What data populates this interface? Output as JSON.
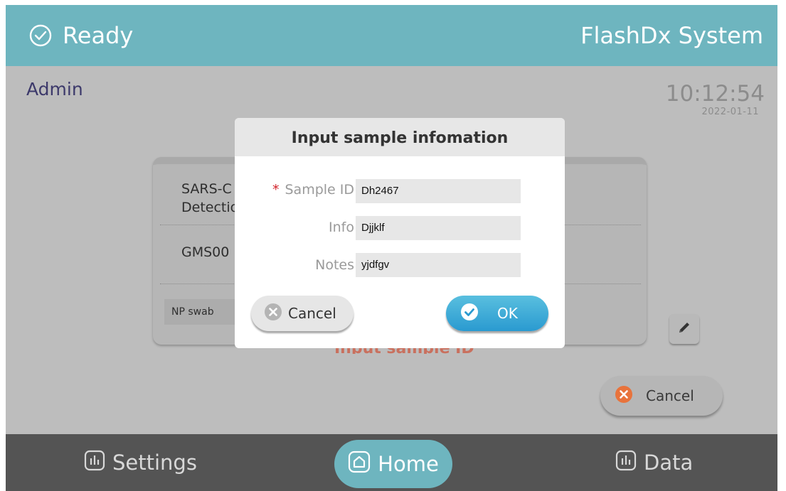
{
  "header": {
    "status_text": "Ready",
    "status_icon": "check-circle-icon",
    "system_title": "FlashDx System"
  },
  "user": {
    "name": "Admin"
  },
  "clock": {
    "time": "10:12:54",
    "date": "2022-01-11"
  },
  "card": {
    "test_name": "SARS-C\nDetectio",
    "kit_code": "GMS00",
    "sample_type": "NP swab"
  },
  "prompt": "Input sample ID",
  "cancel_button": {
    "label": "Cancel"
  },
  "dialog": {
    "title": "Input sample infomation",
    "fields": [
      {
        "label": "Sample ID",
        "required": true,
        "value": "Dh2467"
      },
      {
        "label": "Info",
        "required": false,
        "value": "Djjklf"
      },
      {
        "label": "Notes",
        "required": false,
        "value": "yjdfgv"
      }
    ],
    "cancel_label": "Cancel",
    "ok_label": "OK"
  },
  "nav": {
    "settings_label": "Settings",
    "home_label": "Home",
    "data_label": "Data"
  },
  "colors": {
    "header": "#6eb5bf",
    "footer": "#545454",
    "ok_button": "#2a9ad0",
    "required": "#d2232a",
    "cancel_icon": "#e8733c"
  }
}
